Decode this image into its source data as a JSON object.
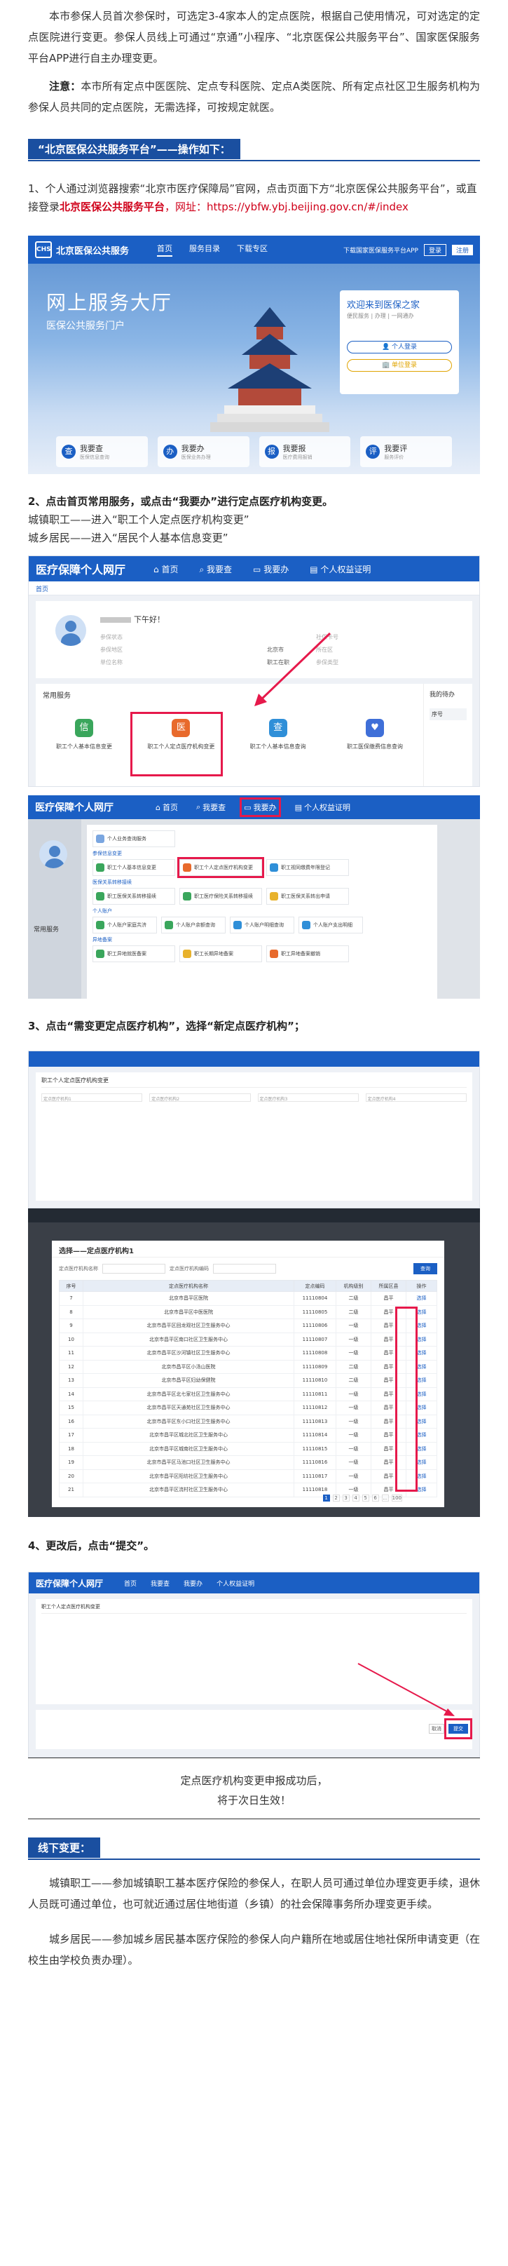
{
  "intro": {
    "p1": "本市参保人员首次参保时，可选定3-4家本人的定点医院，根据自己使用情况，可对选定的定点医院进行变更。参保人员线上可通过“京通”小程序、“北京医保公共服务平台”、国家医保服务平台APP进行自主办理变更。",
    "note_label": "注意：",
    "note_text": "本市所有定点中医医院、定点专科医院、定点A类医院、所有定点社区卫生服务机构为参保人员共同的定点医院，无需选择，可按规定就医。"
  },
  "section_online": {
    "heading": "“北京医保公共服务平台”——操作如下："
  },
  "step1": {
    "text_a": "1、个人通过浏览器搜索“北京市医疗保障局”官网，点击页面下方“北京医保公共服务平台”，或直接登录",
    "highlight": "北京医保公共服务平台",
    "text_b": "，网址：https://ybfw.ybj.beijing.gov.cn/#/index"
  },
  "shot1": {
    "logo": "CHS",
    "brand": "北京医保公共服务",
    "nav": [
      "首页",
      "服务目录",
      "下载专区"
    ],
    "right_link": "下载国家医保服务平台APP",
    "login": "登录",
    "register": "注册",
    "title": "网上服务大厅",
    "subtitle": "医保公共服务门户",
    "card_title": "欢迎来到医保之家",
    "card_sub": "便民服务 | 办理 | 一网通办",
    "btn_personal": "个人登录",
    "btn_unit": "单位登录",
    "tiles": [
      {
        "icon": "查",
        "title": "我要查",
        "sub": "医保信息查询"
      },
      {
        "icon": "办",
        "title": "我要办",
        "sub": "医保业务办理"
      },
      {
        "icon": "报",
        "title": "我要报",
        "sub": "医疗费用报销"
      },
      {
        "icon": "评",
        "title": "我要评",
        "sub": "服务评价"
      }
    ]
  },
  "step2": {
    "title": "2、点击首页常用服务，或点击“我要办”进行定点医疗机构变更。",
    "line1": "城镇职工——进入“职工个人定点医疗机构变更”",
    "line2": "城乡居民——进入“居民个人基本信息变更”"
  },
  "shot2": {
    "brand": "医疗保障个人网厅",
    "nav": [
      "首页",
      "我要查",
      "我要办",
      "个人权益证明"
    ],
    "crumb": "首页",
    "greeting": "下午好！",
    "fields": [
      "参保状态",
      "参保地区",
      "单位名称",
      "社保卡号",
      "所在区",
      "参保类型"
    ],
    "values": [
      "北京市",
      "职工在职"
    ],
    "services_title": "常用服务",
    "aside_title": "我的待办",
    "aside_col": "序号",
    "services": [
      {
        "label": "职工个人基本信息变更",
        "icon": "信",
        "color": "#3aa65c"
      },
      {
        "label": "职工个人定点医疗机构变更",
        "icon": "医",
        "color": "#e86a2c"
      },
      {
        "label": "职工个人基本信息查询",
        "icon": "查",
        "color": "#2f8fd8"
      },
      {
        "label": "职工医保缴费信息查询",
        "icon": "♥",
        "color": "#3f6fd8"
      }
    ]
  },
  "shot3": {
    "brand": "医疗保障个人网厅",
    "nav": [
      "首页",
      "我要查",
      "我要办",
      "个人权益证明"
    ],
    "left_labels": [
      "常用服务"
    ],
    "sections": [
      {
        "title": "",
        "items": [
          "个人业务查询服务"
        ]
      },
      {
        "title": "参保信息变更",
        "items": [
          "职工个人基本信息变更",
          "职工个人定点医疗机构变更",
          "职工视同缴费年限登记"
        ]
      },
      {
        "title": "医保关系转移接续",
        "items": [
          "职工医保关系转移接续",
          "职工医疗保险关系转移接续",
          "职工医保关系转出申请"
        ]
      },
      {
        "title": "个人账户",
        "items": [
          "个人账户家庭共济",
          "个人账户余额查询",
          "个人账户明细查询",
          "个人账户支出明细"
        ]
      },
      {
        "title": "异地备案",
        "items": [
          "职工异地就医备案",
          "职工长期异地备案",
          "职工异地备案撤销"
        ]
      }
    ]
  },
  "step3": {
    "title": "3、点击“需变更定点医疗机构”，选择“新定点医疗机构”；"
  },
  "shot4": {
    "title": "职工个人定点医疗机构变更",
    "fields": [
      "定点医疗机构1",
      "定点医疗机构2",
      "定点医疗机构3",
      "定点医疗机构4"
    ]
  },
  "shot5": {
    "modal_title": "选择——定点医疗机构1",
    "search_label1": "定点医疗机构名称",
    "search_label2": "定点医疗机构编码",
    "query": "查询",
    "columns": [
      "序号",
      "定点医疗机构名称",
      "定点编码",
      "机构级别",
      "所属区县",
      "操作"
    ],
    "rows": [
      {
        "no": "7",
        "name": "北京市昌平区医院",
        "code": "11110804",
        "level": "二级",
        "district": "昌平",
        "op": "选择"
      },
      {
        "no": "8",
        "name": "北京市昌平区中医医院",
        "code": "11110805",
        "level": "二级",
        "district": "昌平",
        "op": "选择"
      },
      {
        "no": "9",
        "name": "北京市昌平区回龙观社区卫生服务中心",
        "code": "11110806",
        "level": "一级",
        "district": "昌平",
        "op": "选择"
      },
      {
        "no": "10",
        "name": "北京市昌平区南口社区卫生服务中心",
        "code": "11110807",
        "level": "一级",
        "district": "昌平",
        "op": "选择"
      },
      {
        "no": "11",
        "name": "北京市昌平区沙河镇社区卫生服务中心",
        "code": "11110808",
        "level": "一级",
        "district": "昌平",
        "op": "选择"
      },
      {
        "no": "12",
        "name": "北京市昌平区小汤山医院",
        "code": "11110809",
        "level": "二级",
        "district": "昌平",
        "op": "选择"
      },
      {
        "no": "13",
        "name": "北京市昌平区妇幼保健院",
        "code": "11110810",
        "level": "二级",
        "district": "昌平",
        "op": "选择"
      },
      {
        "no": "14",
        "name": "北京市昌平区北七家社区卫生服务中心",
        "code": "11110811",
        "level": "一级",
        "district": "昌平",
        "op": "选择"
      },
      {
        "no": "15",
        "name": "北京市昌平区天通苑社区卫生服务中心",
        "code": "11110812",
        "level": "一级",
        "district": "昌平",
        "op": "选择"
      },
      {
        "no": "16",
        "name": "北京市昌平区东小口社区卫生服务中心",
        "code": "11110813",
        "level": "一级",
        "district": "昌平",
        "op": "选择"
      },
      {
        "no": "17",
        "name": "北京市昌平区城北社区卫生服务中心",
        "code": "11110814",
        "level": "一级",
        "district": "昌平",
        "op": "选择"
      },
      {
        "no": "18",
        "name": "北京市昌平区城南社区卫生服务中心",
        "code": "11110815",
        "level": "一级",
        "district": "昌平",
        "op": "选择"
      },
      {
        "no": "19",
        "name": "北京市昌平区马池口社区卫生服务中心",
        "code": "11110816",
        "level": "一级",
        "district": "昌平",
        "op": "选择"
      },
      {
        "no": "20",
        "name": "北京市昌平区阳坊社区卫生服务中心",
        "code": "11110817",
        "level": "一级",
        "district": "昌平",
        "op": "选择"
      },
      {
        "no": "21",
        "name": "北京市昌平区流村社区卫生服务中心",
        "code": "11110818",
        "level": "一级",
        "district": "昌平",
        "op": "选择"
      }
    ],
    "pager": [
      "1",
      "2",
      "3",
      "4",
      "5",
      "6",
      "...",
      "100"
    ]
  },
  "step4": {
    "title": "4、更改后，点击“提交”。"
  },
  "shot6": {
    "brand": "医疗保障个人网厅",
    "nav": [
      "首页",
      "我要查",
      "我要办",
      "个人权益证明"
    ],
    "title": "职工个人定点医疗机构变更",
    "cancel": "取消",
    "submit": "提交"
  },
  "result": {
    "line1": "定点医疗机构变更申报成功后，",
    "line2": "将于次日生效！"
  },
  "section_offline": {
    "heading": "线下变更："
  },
  "offline": {
    "p1": "城镇职工——参加城镇职工基本医疗保险的参保人，在职人员可通过单位办理变更手续，退休人员既可通过单位，也可就近通过居住地街道（乡镇）的社会保障事务所办理变更手续。",
    "p2": "城乡居民——参加城乡居民基本医疗保险的参保人向户籍所在地或居住地社保所申请变更（在校生由学校负责办理）。"
  },
  "colors": {
    "accent": "#1a4fa0",
    "highlight": "#d0021b",
    "callout": "#e6194b"
  }
}
